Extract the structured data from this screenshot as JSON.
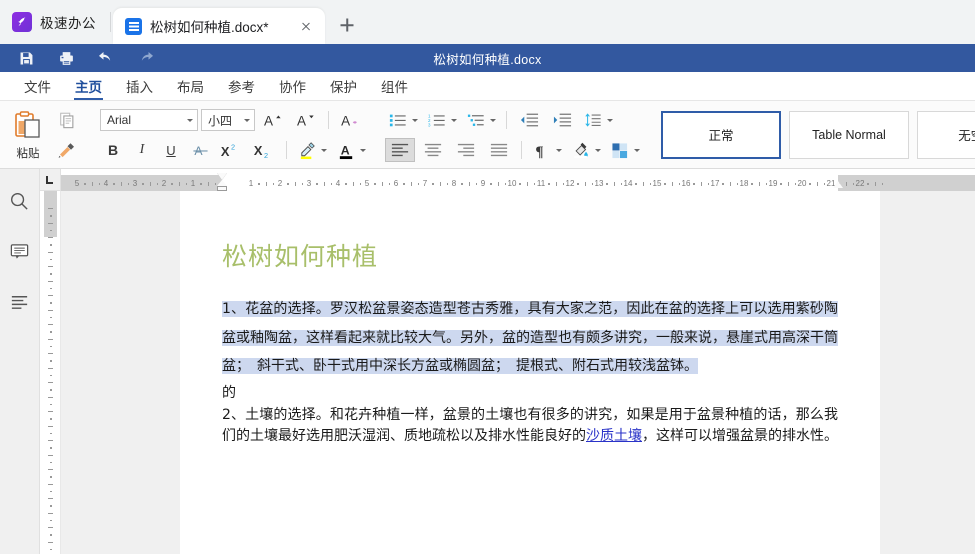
{
  "browser": {
    "brand": "极速办公",
    "brand_icon": "rocket-icon",
    "tab": {
      "title": "松树如何种植.docx*",
      "icon": "document-icon",
      "close_icon": "close-icon"
    },
    "new_tab_icon": "plus-icon"
  },
  "titlebar": {
    "document_title": "松树如何种植.docx",
    "quick_access": [
      {
        "name": "save-button",
        "icon": "save-icon"
      },
      {
        "name": "print-button",
        "icon": "print-icon"
      },
      {
        "name": "undo-button",
        "icon": "undo-icon"
      },
      {
        "name": "redo-button",
        "icon": "redo-icon"
      }
    ]
  },
  "menu": {
    "items": [
      {
        "label": "文件",
        "active": false
      },
      {
        "label": "主页",
        "active": true
      },
      {
        "label": "插入",
        "active": false
      },
      {
        "label": "布局",
        "active": false
      },
      {
        "label": "参考",
        "active": false
      },
      {
        "label": "协作",
        "active": false
      },
      {
        "label": "保护",
        "active": false
      },
      {
        "label": "组件",
        "active": false
      }
    ]
  },
  "ribbon": {
    "clipboard": {
      "paste_label": "粘贴",
      "paste_icon": "clipboard-icon",
      "copy_icon": "copy-icon",
      "format_painter_icon": "format-painter-icon"
    },
    "font": {
      "family_value": "Arial",
      "size_value": "小四",
      "grow_label": "A",
      "shrink_label": "A",
      "clear_format_label": "A",
      "bold_label": "B",
      "italic_label": "I",
      "underline_label": "U",
      "strike_label": "A",
      "superscript_label": "X²",
      "subscript_label": "X₂",
      "highlight_icon": "highlighter-icon",
      "highlight_color": "#ffff00",
      "fontcolor_icon": "font-color-icon",
      "fontcolor_color": "#000000"
    },
    "paragraph": {
      "bullets_icon": "bullet-list-icon",
      "numbering_icon": "numbered-list-icon",
      "multilevel_icon": "multilevel-list-icon",
      "indent_decrease_icon": "decrease-indent-icon",
      "indent_increase_icon": "increase-indent-icon",
      "line_spacing_icon": "line-spacing-icon",
      "align_left_icon": "align-left-icon",
      "align_center_icon": "align-center-icon",
      "align_right_icon": "align-right-icon",
      "align_justify_icon": "align-justify-icon",
      "show_marks_icon": "pilcrow-icon",
      "shading_icon": "shading-icon",
      "borders_icon": "borders-icon"
    },
    "styles": [
      {
        "label": "正常",
        "selected": true
      },
      {
        "label": "Table Normal",
        "selected": false
      },
      {
        "label": "无空格",
        "selected": false
      }
    ]
  },
  "rail": {
    "items": [
      {
        "name": "search-icon",
        "label": "查找"
      },
      {
        "name": "comment-icon",
        "label": "批注"
      },
      {
        "name": "outline-icon",
        "label": "导航"
      }
    ]
  },
  "rulers": {
    "tab_stop_icon": "tab-stop-left-icon",
    "horizontal_ticks": [
      "3",
      "2",
      "1",
      "1",
      "2",
      "3",
      "4",
      "5",
      "6",
      "7",
      "8",
      "9",
      "10",
      "11",
      "12",
      "13",
      "14",
      "15",
      "16",
      "17"
    ],
    "left_margin_marker": "indent-marker",
    "right_margin_marker": "indent-marker"
  },
  "document": {
    "title": "松树如何种植",
    "title_color": "#a8bf6a",
    "selection_color": "#cdd8ef",
    "paragraphs": [
      {
        "id": "p1",
        "selected": true,
        "text": "1、花盆的选择。罗汉松盆景姿态造型苍古秀雅，具有大家之范，因此在盆的选择上可以选用紫砂陶盆或釉陶盆，这样看起来就比较大气。另外，盆的造型也有颇多讲究，一般来说，悬崖式用高深干筒盆；　斜干式、卧干式用中深长方盆或椭圆盆；　提根式、附石式用较浅盆钵。"
      },
      {
        "id": "p2",
        "selected": false,
        "text": "的"
      },
      {
        "id": "p3",
        "selected": false,
        "text_before": "2、土壤的选择。和花卉种植一样，盆景的土壤也有很多的讲究，如果是用于盆景种植的话，那么我们的土壤最好选用肥沃湿润、质地疏松以及排水性能良好的",
        "link_text": "沙质土壤",
        "text_after": "，这样可以增强盆景的排水性。"
      }
    ]
  }
}
